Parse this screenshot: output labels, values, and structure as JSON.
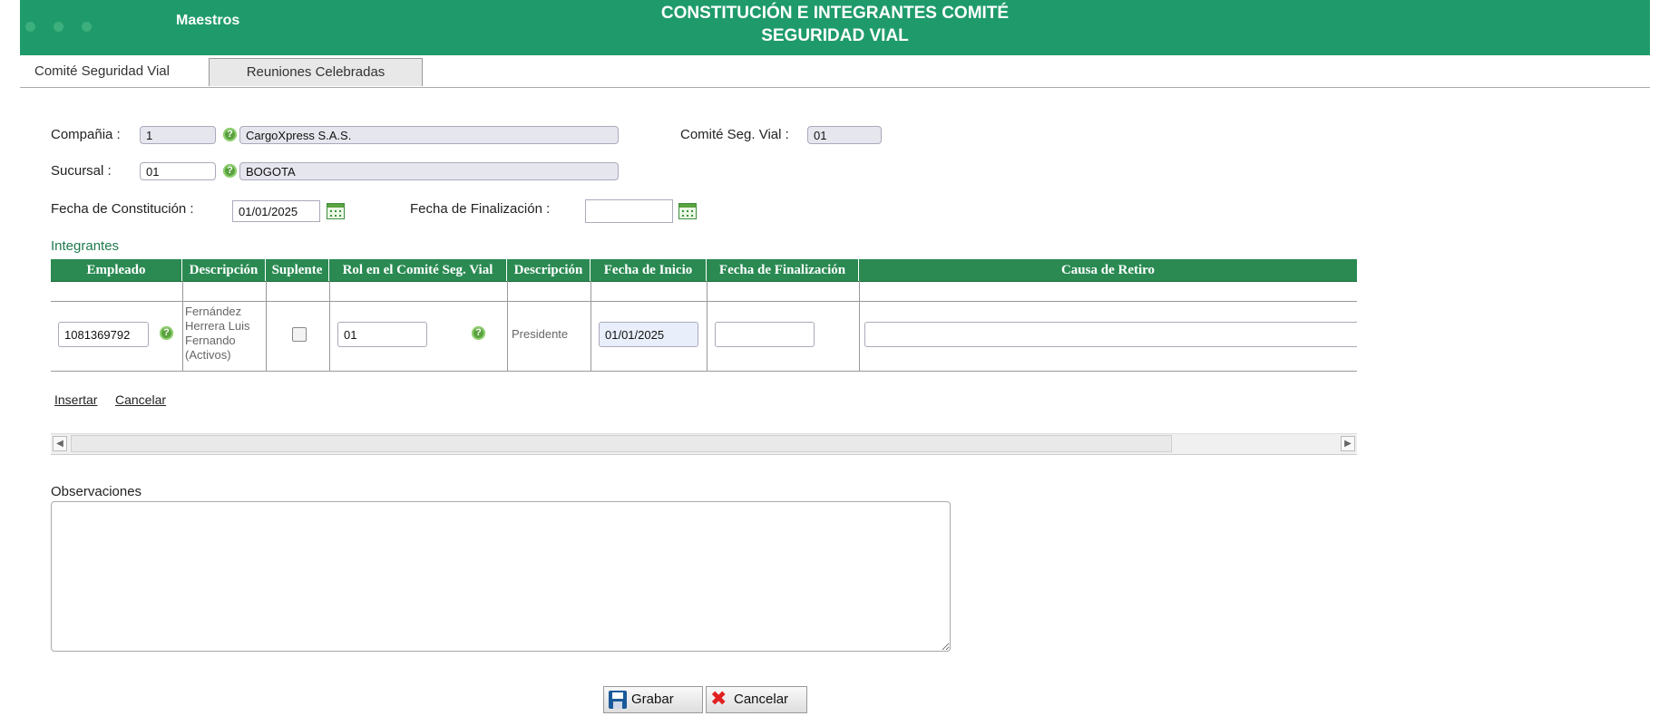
{
  "header": {
    "brand": "Maestros",
    "title_line1": "CONSTITUCIÓN E INTEGRANTES COMITÉ",
    "title_line2": "SEGURIDAD VIAL",
    "color": "#1f9b6b"
  },
  "tabs": [
    {
      "label": "Comité Seguridad Vial",
      "active": true
    },
    {
      "label": "Reuniones Celebradas",
      "active": false
    }
  ],
  "form": {
    "compania_label": "Compañia :",
    "compania_code": "1",
    "compania_name": "CargoXpress S.A.S.",
    "comite_label": "Comité Seg. Vial :",
    "comite_value": "01",
    "sucursal_label": "Sucursal :",
    "sucursal_code": "01",
    "sucursal_name": "BOGOTA",
    "fecha_const_label": "Fecha de Constitución :",
    "fecha_const_value": "01/01/2025",
    "fecha_fin_label": "Fecha de Finalización :",
    "fecha_fin_value": ""
  },
  "integrantes": {
    "title": "Integrantes",
    "columns": [
      "Empleado",
      "Descripción",
      "Suplente",
      "Rol en el Comité Seg. Vial",
      "Descripción",
      "Fecha de Inicio",
      "Fecha de Finalización",
      "Causa de Retiro"
    ],
    "row": {
      "empleado": "1081369792",
      "descripcion": "Fernández Herrera Luis Fernando (Activos)",
      "suplente": false,
      "rol": "01",
      "rol_descripcion": "Presidente",
      "fecha_inicio": "01/01/2025",
      "fecha_fin": "",
      "causa_retiro": ""
    },
    "insert_label": "Insertar",
    "cancel_label": "Cancelar"
  },
  "observaciones": {
    "label": "Observaciones",
    "value": ""
  },
  "buttons": {
    "save": "Grabar",
    "cancel": "Cancelar"
  }
}
